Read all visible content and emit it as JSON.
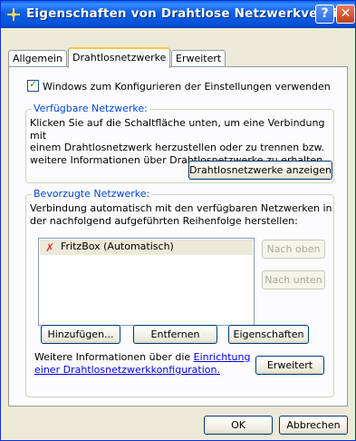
{
  "window": {
    "title": "Eigenschaften von Drahtlose Netzwerkverbi...",
    "help_label": "?",
    "close_label": "✕"
  },
  "tabs": [
    {
      "label": "Allgemein"
    },
    {
      "label": "Drahtlosnetzwerke",
      "active": true
    },
    {
      "label": "Erweitert"
    }
  ],
  "checkbox": {
    "label": "Windows zum Konfigurieren der Einstellungen verwenden",
    "checked": true
  },
  "available": {
    "title": "Verfügbare Netzwerke:",
    "line1": "Klicken Sie auf die Schaltfläche unten, um eine Verbindung mit",
    "line2": "einem Drahtlosnetzwerk herzustellen oder zu trennen bzw.",
    "line3": "weitere Informationen über Drahtlosnetzwerke zu erhalten.",
    "button": "Drahtlosnetzwerke anzeigen"
  },
  "preferred": {
    "title": "Bevorzugte Netzwerke:",
    "line1": "Verbindung automatisch mit den verfügbaren Netzwerken in",
    "line2": "der nachfolgend aufgeführten Reihenfolge herstellen:",
    "networks": [
      {
        "name": "FritzBox (Automatisch)"
      }
    ],
    "move_up": "Nach oben",
    "move_down": "Nach unten",
    "add": "Hinzufügen...",
    "remove": "Entfernen",
    "properties": "Eigenschaften",
    "info_prefix": "Weitere Informationen über die ",
    "info_link1": "Einrichtung",
    "info_link2": "einer Drahtlosnetzwerkkonfiguration.",
    "advanced": "Erweitert"
  },
  "footer": {
    "ok": "OK",
    "cancel": "Abbrechen"
  }
}
